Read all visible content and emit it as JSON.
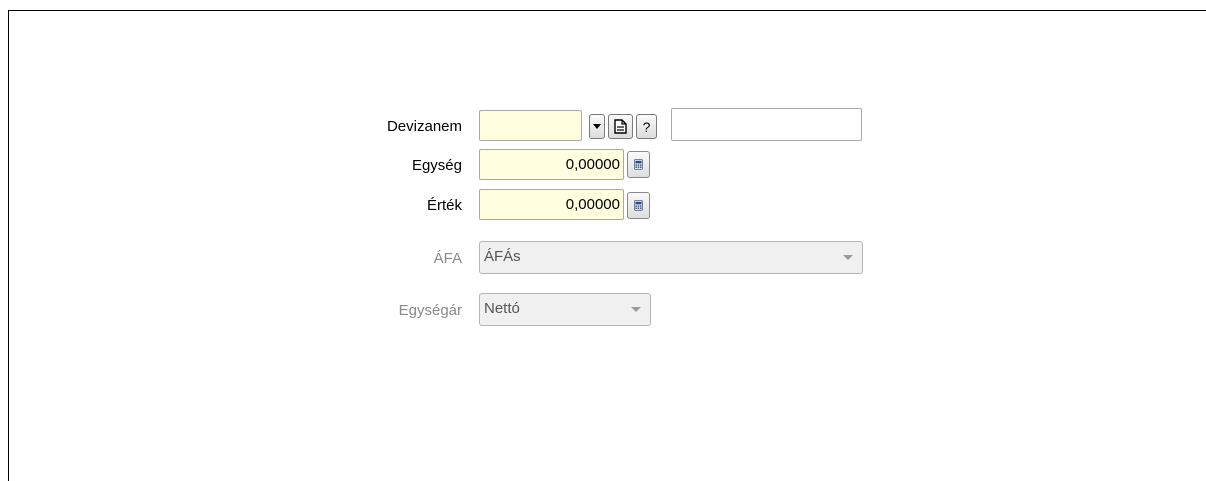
{
  "form": {
    "devizanem": {
      "label": "Devizanem",
      "value": "",
      "name_value": "",
      "dropdown_icon": "small-down-arrow-icon",
      "doc_icon": "document-icon",
      "help_label": "?"
    },
    "egyseg": {
      "label": "Egység",
      "value": "0,00000",
      "calc_icon": "calculator-icon"
    },
    "ertek": {
      "label": "Érték",
      "value": "0,00000",
      "calc_icon": "calculator-icon"
    },
    "afa": {
      "label": "ÁFA",
      "selected": "ÁFÁs",
      "disabled": true
    },
    "egysegar": {
      "label": "Egységár",
      "selected": "Nettó",
      "disabled": true
    }
  },
  "colors": {
    "input_background": "#ffffe0",
    "disabled_text": "#8a8a8a",
    "calculator_screen": "#1f4e9c"
  }
}
